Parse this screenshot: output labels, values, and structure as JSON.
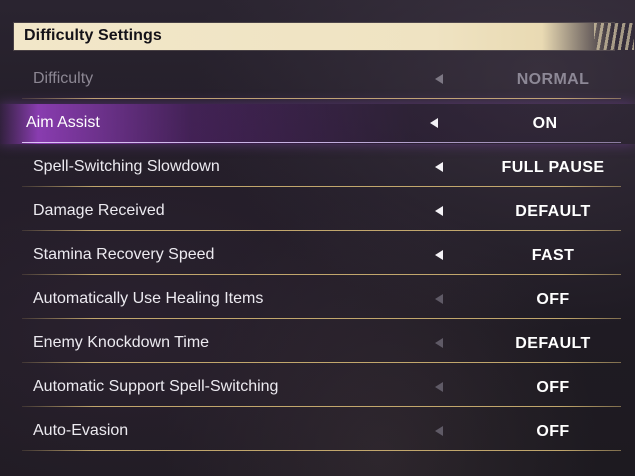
{
  "header": {
    "title": "Difficulty Settings"
  },
  "settings": [
    {
      "label": "Difficulty",
      "value": "NORMAL",
      "state": "disabled",
      "arrow_enabled": true
    },
    {
      "label": "Aim Assist",
      "value": "ON",
      "state": "selected",
      "arrow_enabled": true
    },
    {
      "label": "Spell-Switching Slowdown",
      "value": "FULL PAUSE",
      "state": "normal",
      "arrow_enabled": true
    },
    {
      "label": "Damage Received",
      "value": "DEFAULT",
      "state": "normal",
      "arrow_enabled": true
    },
    {
      "label": "Stamina Recovery Speed",
      "value": "FAST",
      "state": "normal",
      "arrow_enabled": true
    },
    {
      "label": "Automatically Use Healing Items",
      "value": "OFF",
      "state": "normal",
      "arrow_enabled": false
    },
    {
      "label": "Enemy Knockdown Time",
      "value": "DEFAULT",
      "state": "normal",
      "arrow_enabled": true
    },
    {
      "label": "Automatic Support Spell-Switching",
      "value": "OFF",
      "state": "normal",
      "arrow_enabled": false
    },
    {
      "label": "Auto-Evasion",
      "value": "OFF",
      "state": "normal",
      "arrow_enabled": false
    }
  ],
  "colors": {
    "header_bg": "#f2e7c9",
    "selection_purple": "#aa46dc",
    "divider_gold": "#dcbe78",
    "disabled_text": "#8c8793"
  },
  "icons": {
    "left_arrow": "left-arrow-icon"
  }
}
